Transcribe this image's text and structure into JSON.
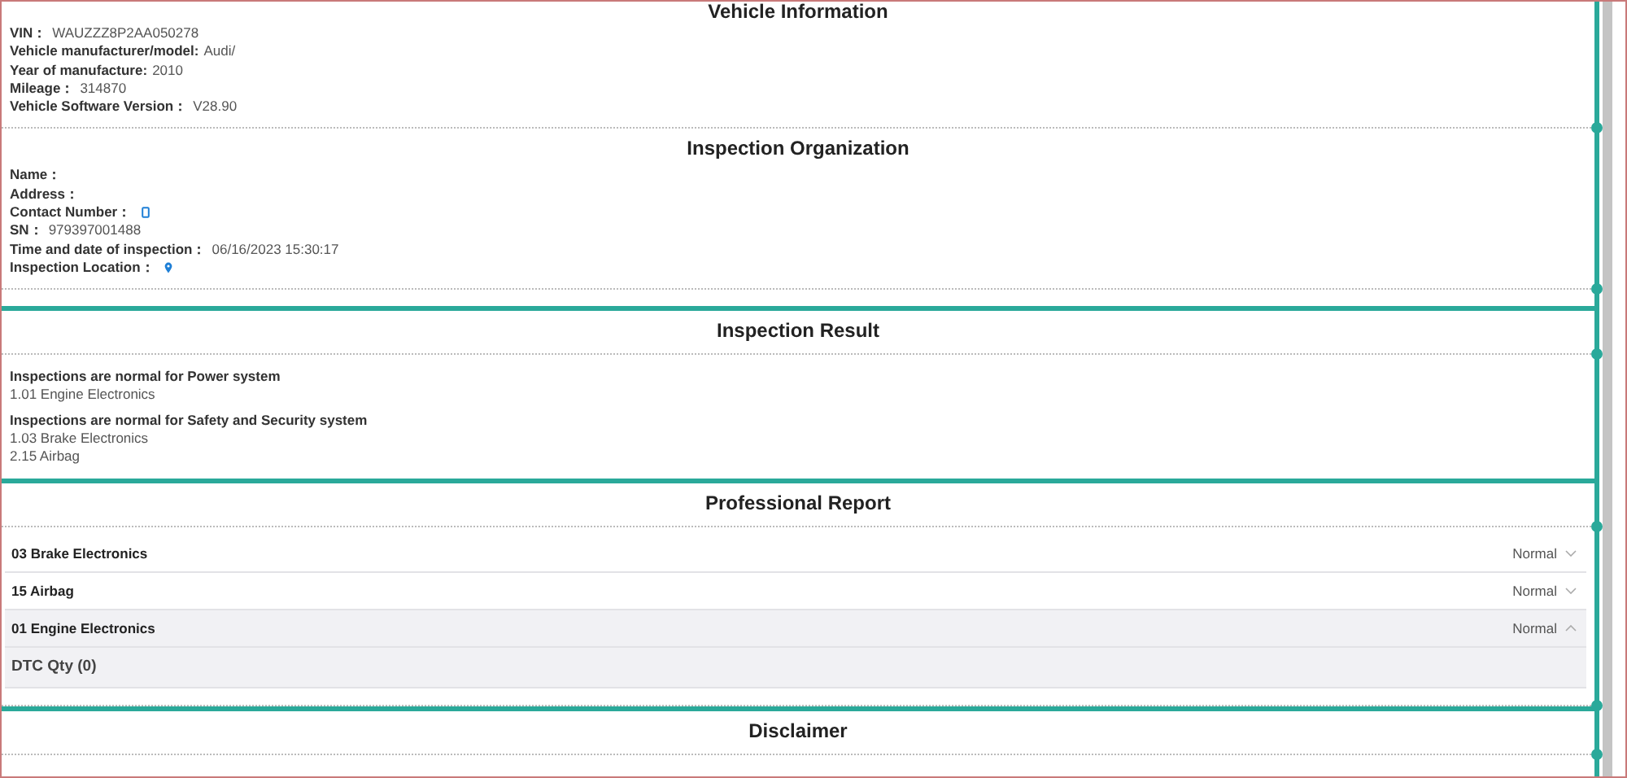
{
  "cards": [
    {
      "sections": [
        {
          "kind": "fields",
          "title": "Vehicle Information",
          "fields": [
            {
              "label": "VIN：",
              "value": "WAUZZZ8P2AA050278"
            },
            {
              "label": "Vehicle manufacturer/model:",
              "value": "Audi/"
            },
            {
              "label": "Year of manufacture:",
              "value": "2010"
            },
            {
              "label": "Mileage：",
              "value": "314870"
            },
            {
              "label": "Vehicle Software Version：",
              "value": "V28.90"
            }
          ]
        },
        {
          "kind": "fields",
          "title": "Inspection Organization",
          "fields": [
            {
              "label": "Name："
            },
            {
              "label": "Address："
            },
            {
              "label": "Contact Number：",
              "kind": "phone"
            },
            {
              "label": "SN：",
              "value": "979397001488"
            },
            {
              "label": "Time and date of inspection：",
              "value": "06/16/2023 15:30:17"
            },
            {
              "label": "Inspection Location：",
              "kind": "pin"
            }
          ]
        }
      ]
    },
    {
      "sections": [
        {
          "kind": "results",
          "title": "Inspection Result",
          "groups": [
            {
              "heading": "Inspections are normal for Power system",
              "items": [
                "1.01 Engine Electronics"
              ]
            },
            {
              "heading": "Inspections are normal for Safety and Security system",
              "items": [
                "1.03 Brake Electronics",
                "2.15 Airbag"
              ]
            }
          ]
        }
      ]
    },
    {
      "sections": [
        {
          "kind": "report",
          "title": "Professional Report",
          "rows": [
            {
              "name": "03 Brake Electronics",
              "status": "Normal",
              "expanded": false
            },
            {
              "name": "15 Airbag",
              "status": "Normal",
              "expanded": false
            },
            {
              "name": "01 Engine Electronics",
              "status": "Normal",
              "expanded": true,
              "detail": "DTC Qty (0)"
            }
          ]
        }
      ]
    },
    {
      "sections": [
        {
          "kind": "empty",
          "title": "Disclaimer"
        }
      ]
    }
  ]
}
